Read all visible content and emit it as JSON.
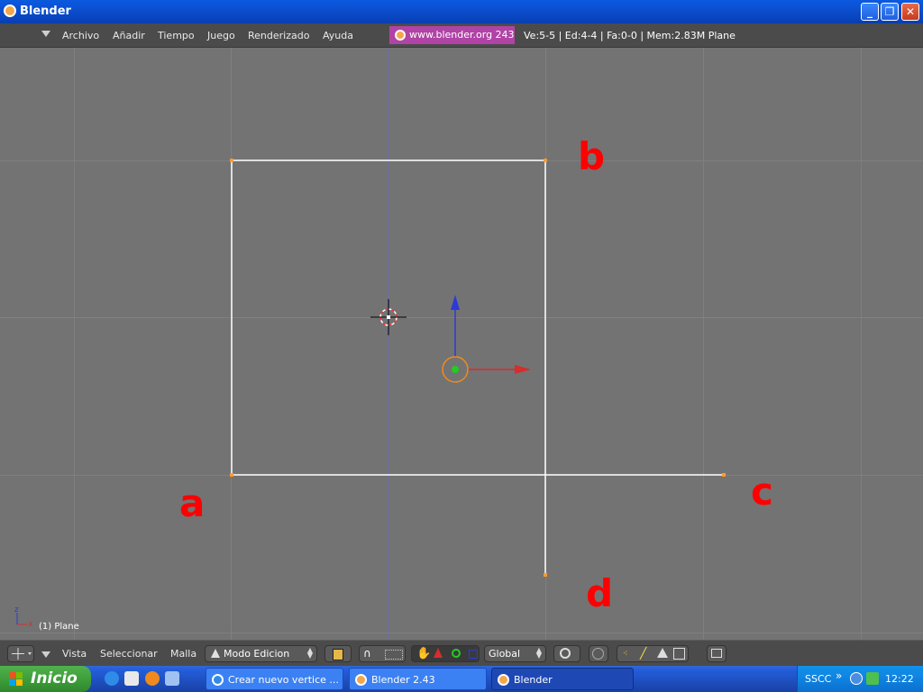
{
  "window": {
    "title": "Blender"
  },
  "menu": {
    "items": [
      "Archivo",
      "Añadir",
      "Tiempo",
      "Juego",
      "Renderizado",
      "Ayuda"
    ],
    "url": "www.blender.org 243",
    "stats": "Ve:5-5 | Ed:4-4 | Fa:0-0 | Mem:2.83M Plane"
  },
  "viewport": {
    "annotations": [
      "b",
      "a",
      "c",
      "d"
    ],
    "object_label": "(1) Plane",
    "axis_labels": [
      "z",
      "x"
    ],
    "colors": {
      "annotation": "#ff0000",
      "edge": "#ffffff",
      "vertex": "#ff9a2e",
      "x_axis": "#d62d2d",
      "z_axis": "#2d3ad6"
    }
  },
  "view_header": {
    "menus": [
      "Vista",
      "Seleccionar",
      "Malla"
    ],
    "mode": "Modo Edicion",
    "orientation": "Global"
  },
  "taskbar": {
    "start": "Inicio",
    "tasks": [
      "Crear nuevo vertice ...",
      "Blender 2.43",
      "Blender"
    ],
    "tray_label": "SSCC",
    "clock": "12:22"
  }
}
